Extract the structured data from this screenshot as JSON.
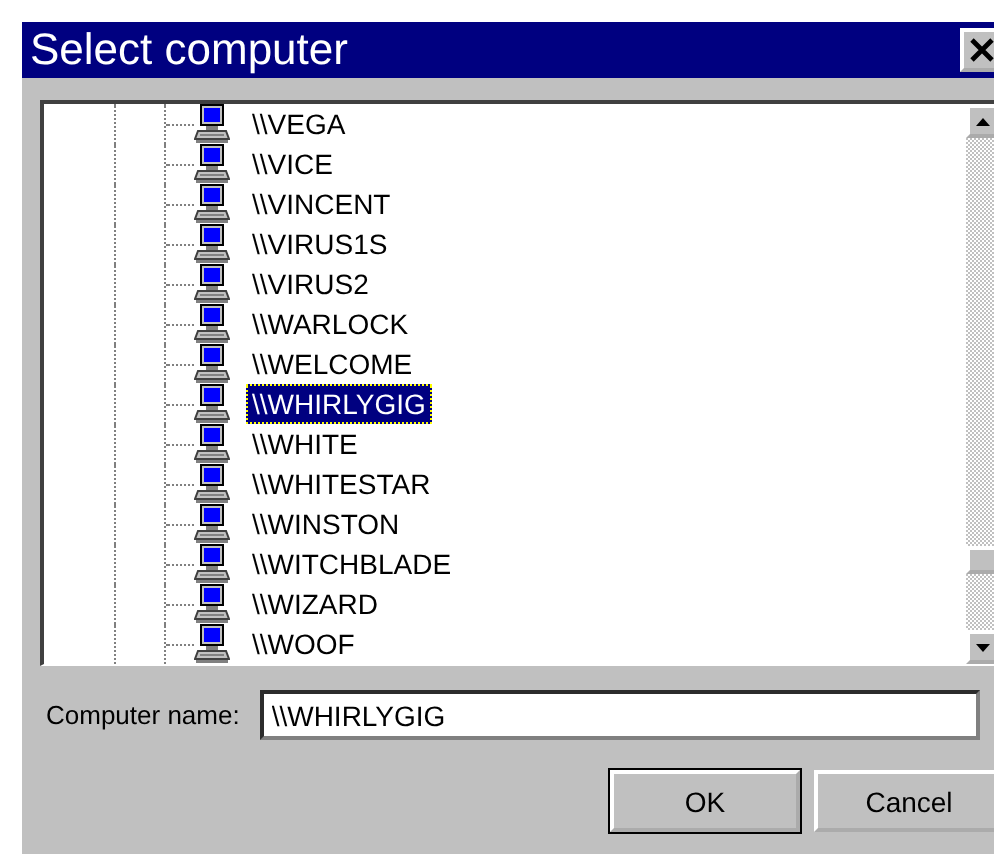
{
  "window": {
    "title": "Select computer"
  },
  "computers": [
    {
      "name": "\\\\VEGA",
      "selected": false
    },
    {
      "name": "\\\\VICE",
      "selected": false
    },
    {
      "name": "\\\\VINCENT",
      "selected": false
    },
    {
      "name": "\\\\VIRUS1S",
      "selected": false
    },
    {
      "name": "\\\\VIRUS2",
      "selected": false
    },
    {
      "name": "\\\\WARLOCK",
      "selected": false
    },
    {
      "name": "\\\\WELCOME",
      "selected": false
    },
    {
      "name": "\\\\WHIRLYGIG",
      "selected": true
    },
    {
      "name": "\\\\WHITE",
      "selected": false
    },
    {
      "name": "\\\\WHITESTAR",
      "selected": false
    },
    {
      "name": "\\\\WINSTON",
      "selected": false
    },
    {
      "name": "\\\\WITCHBLADE",
      "selected": false
    },
    {
      "name": "\\\\WIZARD",
      "selected": false
    },
    {
      "name": "\\\\WOOF",
      "selected": false
    }
  ],
  "computer_name": {
    "label": "Computer name:",
    "value": "\\\\WHIRLYGIG"
  },
  "buttons": [
    "OK",
    "Cancel"
  ]
}
